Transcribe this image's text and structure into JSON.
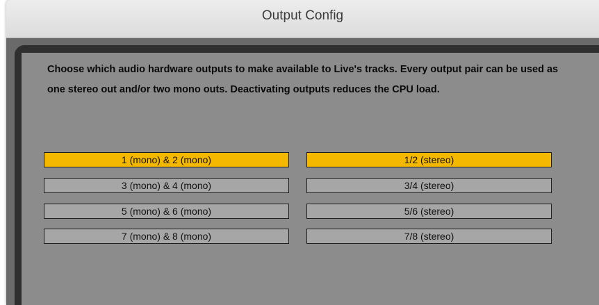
{
  "window": {
    "title": "Output Config"
  },
  "description": "Choose which audio hardware outputs to make available to Live's tracks. Every output pair can be used as one stereo out and/or two mono outs.  Deactivating outputs reduces the CPU load.",
  "colors": {
    "active": "#f5b800",
    "inactive": "#a6a6a6",
    "panel": "#8c8c8c"
  },
  "outputs": [
    {
      "mono_label": "1 (mono) & 2 (mono)",
      "mono_active": true,
      "stereo_label": "1/2 (stereo)",
      "stereo_active": true
    },
    {
      "mono_label": "3 (mono) & 4 (mono)",
      "mono_active": false,
      "stereo_label": "3/4 (stereo)",
      "stereo_active": false
    },
    {
      "mono_label": "5 (mono) & 6 (mono)",
      "mono_active": false,
      "stereo_label": "5/6 (stereo)",
      "stereo_active": false
    },
    {
      "mono_label": "7 (mono) & 8 (mono)",
      "mono_active": false,
      "stereo_label": "7/8 (stereo)",
      "stereo_active": false
    }
  ]
}
